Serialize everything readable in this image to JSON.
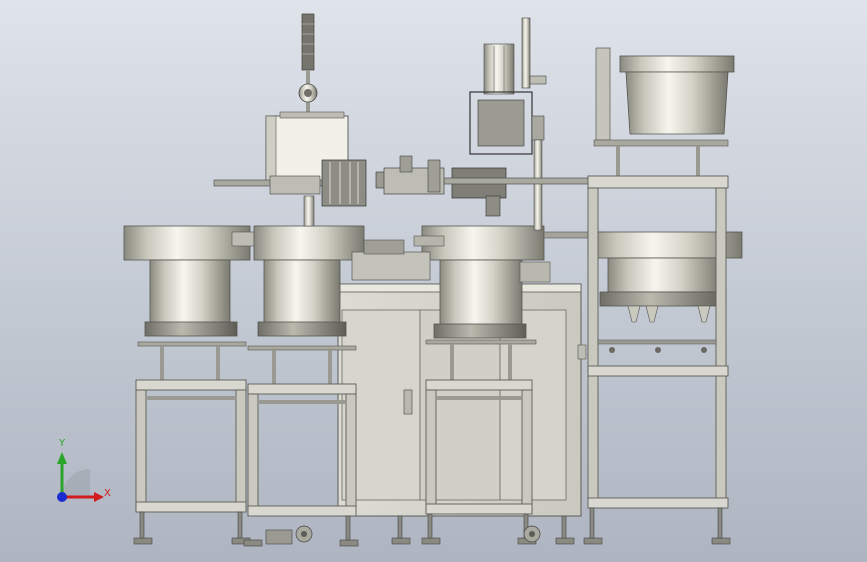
{
  "view": {
    "background_top": "#dfe3ea",
    "background_bottom": "#aeb5c1",
    "metal_light": "#f4f4ee",
    "metal_mid": "#c9c9be",
    "metal_dark": "#8e8e84",
    "frame_color": "#c8c8c0",
    "frame_edge": "#5c5c56"
  },
  "triad": {
    "x_label": "X",
    "y_label": "Y",
    "x_color": "#d21c1c",
    "y_color": "#2aa52a",
    "z_color": "#1c2ad2"
  }
}
